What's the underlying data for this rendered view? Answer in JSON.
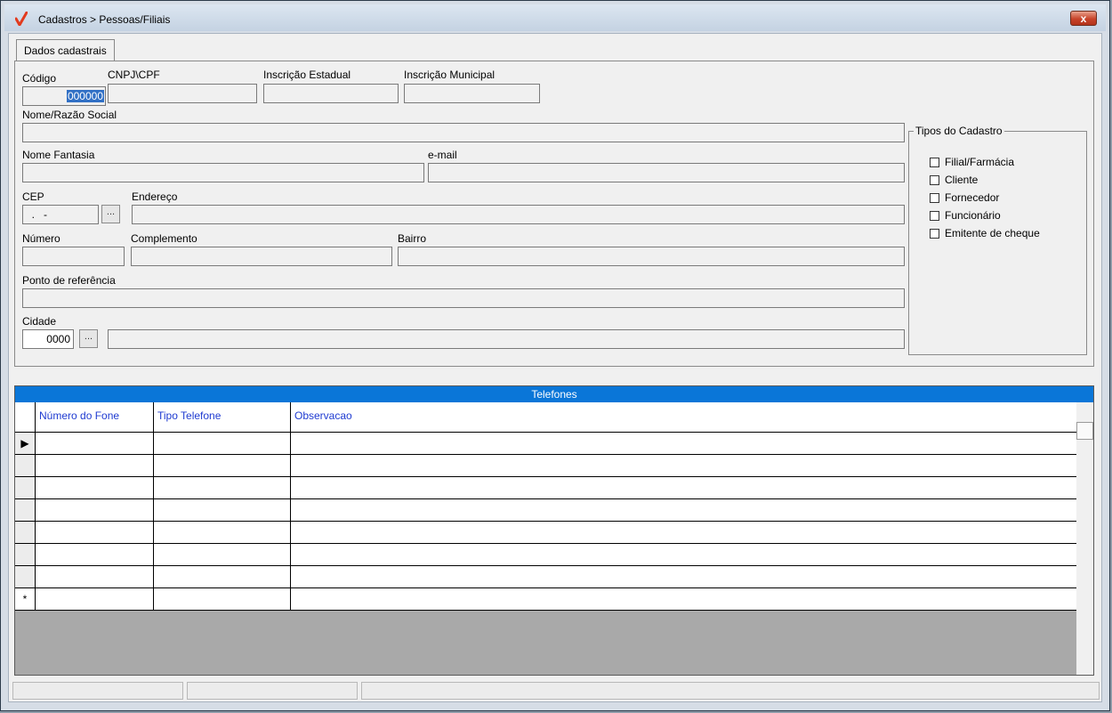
{
  "window": {
    "title": "Cadastros > Pessoas/Filiais",
    "close_label": "x"
  },
  "tabs": [
    {
      "label": "Dados cadastrais"
    }
  ],
  "form": {
    "codigo": {
      "label": "Código",
      "value": "000000"
    },
    "cnpj": {
      "label": "CNPJ\\CPF",
      "value": ""
    },
    "inscricao_estadual": {
      "label": "Inscrição Estadual",
      "value": ""
    },
    "inscricao_municipal": {
      "label": "Inscrição Municipal",
      "value": ""
    },
    "nome": {
      "label": "Nome/Razão Social",
      "value": ""
    },
    "nome_fantasia": {
      "label": "Nome Fantasia",
      "value": ""
    },
    "email": {
      "label": "e-mail",
      "value": ""
    },
    "cep": {
      "label": "CEP",
      "value": "  .   -"
    },
    "endereco": {
      "label": "Endereço",
      "value": ""
    },
    "numero": {
      "label": "Número",
      "value": ""
    },
    "complemento": {
      "label": "Complemento",
      "value": ""
    },
    "bairro": {
      "label": "Bairro",
      "value": ""
    },
    "ponto_referencia": {
      "label": "Ponto de referência",
      "value": ""
    },
    "cidade": {
      "label": "Cidade",
      "code": "0000",
      "name": ""
    },
    "lookup_label": "..."
  },
  "tipos": {
    "title": "Tipos do Cadastro",
    "options": [
      {
        "label": "Filial/Farmácia",
        "checked": false
      },
      {
        "label": "Cliente",
        "checked": false
      },
      {
        "label": "Fornecedor",
        "checked": false
      },
      {
        "label": "Funcionário",
        "checked": false
      },
      {
        "label": "Emitente de cheque",
        "checked": false
      }
    ]
  },
  "telefones": {
    "title": "Telefones",
    "columns": [
      "Número do Fone",
      "Tipo Telefone",
      "Observacao"
    ],
    "row_indicators": [
      "▶",
      "",
      "",
      "",
      "",
      "",
      "",
      "*"
    ]
  },
  "colors": {
    "grid_caption": "#0a76d8",
    "grid_header_text": "#1f3bd1",
    "selection": "#3170c5",
    "close_button": "#c8442a"
  }
}
